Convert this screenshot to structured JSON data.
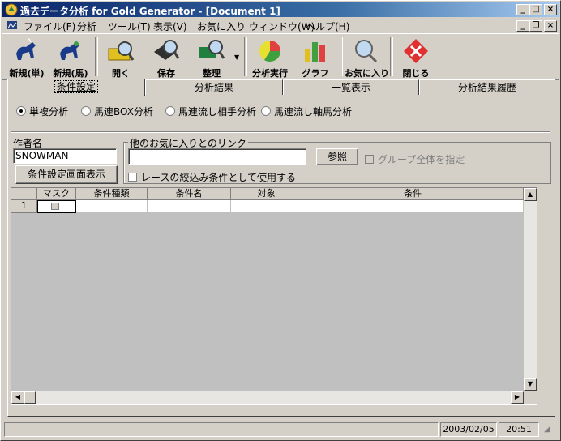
{
  "window": {
    "title": "過去データ分析 for Gold Generator - [Document 1]",
    "caption_buttons": [
      "minimize",
      "maximize",
      "close"
    ]
  },
  "menu": [
    "ファイル(F)",
    "分析",
    "ツール(T)",
    "表示(V)",
    "お気に入り",
    "ウィンドウ(W)",
    "ヘルプ(H)"
  ],
  "toolbar": {
    "new_single": "新規(単)",
    "new_horse": "新規(馬)",
    "open": "開く",
    "save": "保存",
    "organize": "整理",
    "run_analysis": "分析実行",
    "graph": "グラフ",
    "favorites": "お気に入り",
    "close": "閉じる"
  },
  "tabs": [
    "条件設定",
    "分析結果",
    "一覧表示",
    "分析結果履歴"
  ],
  "active_tab": "条件設定",
  "analysis_types": [
    {
      "label": "単複分析",
      "selected": true
    },
    {
      "label": "馬連BOX分析",
      "selected": false
    },
    {
      "label": "馬連流し相手分析",
      "selected": false
    },
    {
      "label": "馬連流し軸馬分析",
      "selected": false
    }
  ],
  "author": {
    "label": "作者名",
    "value": "SNOWMAN"
  },
  "condition_screen_button": "条件設定画面表示",
  "link_group": {
    "label": "他のお気に入りとのリンク",
    "value": "",
    "browse_button": "参照",
    "group_all_checkbox": "グループ全体を指定",
    "use_as_filter_checkbox": "レースの絞込み条件として使用する"
  },
  "grid": {
    "columns": [
      "マスク",
      "条件種類",
      "条件名",
      "対象",
      "条件"
    ],
    "rows": [
      {
        "num": "1",
        "mask": "",
        "type": "",
        "name": "",
        "target": "",
        "condition": ""
      }
    ]
  },
  "status": {
    "date": "2003/02/05",
    "time": "20:51"
  }
}
